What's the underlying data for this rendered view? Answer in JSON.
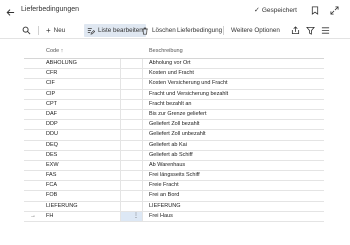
{
  "header": {
    "title": "Lieferbedingungen",
    "saved_label": "Gespeichert"
  },
  "toolbar": {
    "new_label": "Neu",
    "edit_list_label": "Liste bearbeiten",
    "delete_label": "Löschen",
    "delivery_terms_label": "Lieferbedingung",
    "more_options_label": "Weitere Optionen"
  },
  "table": {
    "headers": {
      "code": "Code ↑",
      "description": "Beschreibung"
    },
    "rows": [
      {
        "code": "ABHOLUNG",
        "description": "Abholung vor Ort"
      },
      {
        "code": "CFR",
        "description": "Kosten und Fracht"
      },
      {
        "code": "CIF",
        "description": "Kosten Versicherung und Fracht"
      },
      {
        "code": "CIP",
        "description": "Fracht und Versicherung bezahlt"
      },
      {
        "code": "CPT",
        "description": "Fracht bezahlt an"
      },
      {
        "code": "DAF",
        "description": "Bis zur Grenze geliefert"
      },
      {
        "code": "DDP",
        "description": "Geliefert Zoll bezahlt"
      },
      {
        "code": "DDU",
        "description": "Geliefert Zoll unbezahlt"
      },
      {
        "code": "DEQ",
        "description": "Geliefert ab Kai"
      },
      {
        "code": "DES",
        "description": "Geliefert ab Schiff"
      },
      {
        "code": "EXW",
        "description": "Ab Warenhaus"
      },
      {
        "code": "FAS",
        "description": "Frei längsseits Schiff"
      },
      {
        "code": "FCA",
        "description": "Freie Fracht"
      },
      {
        "code": "FOB",
        "description": "Frei an Bord"
      },
      {
        "code": "LIEFERUNG",
        "description": "LIEFERUNG"
      },
      {
        "code": "FH",
        "description": "Frei Haus"
      }
    ]
  }
}
